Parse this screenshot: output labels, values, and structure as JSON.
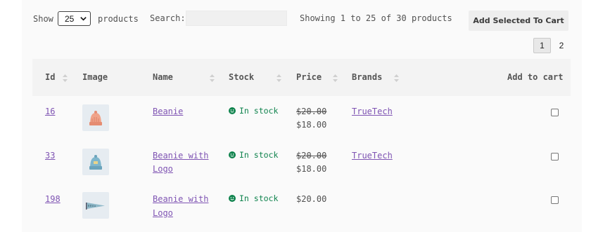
{
  "toolbar": {
    "show_label": "Show",
    "page_size": "25",
    "products_label": "products",
    "search_label": "Search:",
    "search_value": "",
    "showing_text": "Showing 1 to 25 of 30 products",
    "add_selected_label": "Add Selected To Cart"
  },
  "pagination": {
    "current": "1",
    "next": "2"
  },
  "table": {
    "headers": {
      "id": "Id",
      "image": "Image",
      "name": "Name",
      "stock": "Stock",
      "price": "Price",
      "brands": "Brands",
      "add_to_cart": "Add to cart"
    },
    "rows": [
      {
        "id": "16",
        "image": "beanie-icon",
        "name_line1": "Beanie",
        "name_line2": "",
        "stock": "In stock",
        "regular_price": "$20.00",
        "sale_price": "$18.00",
        "brand": "TrueTech",
        "selected": false
      },
      {
        "id": "33",
        "image": "beanie-with-logo-icon",
        "name_line1": "Beanie with",
        "name_line2": "Logo",
        "stock": "In stock",
        "regular_price": "$20.00",
        "sale_price": "$18.00",
        "brand": "TrueTech",
        "selected": false
      },
      {
        "id": "198",
        "image": "pennant-icon",
        "name_line1": "Beanie with",
        "name_line2": "Logo",
        "stock": "In stock",
        "regular_price": "$20.00",
        "sale_price": "",
        "brand": "",
        "selected": false
      }
    ]
  },
  "colors": {
    "link": "#7f54b3",
    "in_stock": "#0f834d",
    "header_bg": "#f3f3f3",
    "panel_bg": "#fafafa"
  }
}
